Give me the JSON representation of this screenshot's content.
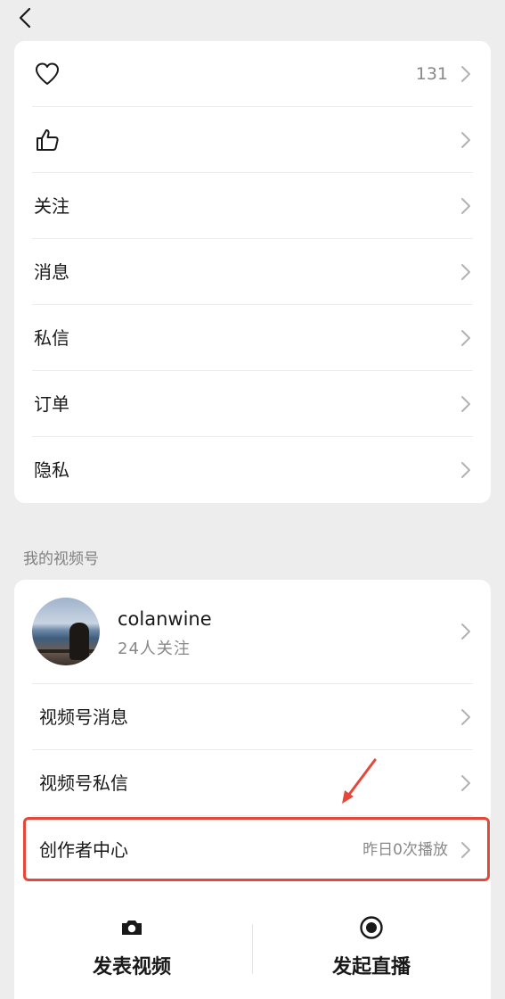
{
  "top_menu": {
    "items": [
      {
        "icon": "heart-icon",
        "label": "",
        "value": "131"
      },
      {
        "icon": "thumbs-up-icon",
        "label": "",
        "value": ""
      },
      {
        "icon": "",
        "label": "关注",
        "value": ""
      },
      {
        "icon": "",
        "label": "消息",
        "value": ""
      },
      {
        "icon": "",
        "label": "私信",
        "value": ""
      },
      {
        "icon": "",
        "label": "订单",
        "value": ""
      },
      {
        "icon": "",
        "label": "隐私",
        "value": ""
      }
    ]
  },
  "channels": {
    "section_title": "我的视频号",
    "profile": {
      "name": "colanwine",
      "followers": "24人关注"
    },
    "items": [
      {
        "label": "视频号消息",
        "value": ""
      },
      {
        "label": "视频号私信",
        "value": ""
      },
      {
        "label": "创作者中心",
        "value": "昨日0次播放"
      }
    ],
    "actions": [
      {
        "label": "发表视频",
        "icon": "camera-icon"
      },
      {
        "label": "发起直播",
        "icon": "live-record-icon"
      }
    ]
  },
  "colors": {
    "highlight": "#e5483a",
    "background": "#ededed",
    "card": "#ffffff"
  }
}
